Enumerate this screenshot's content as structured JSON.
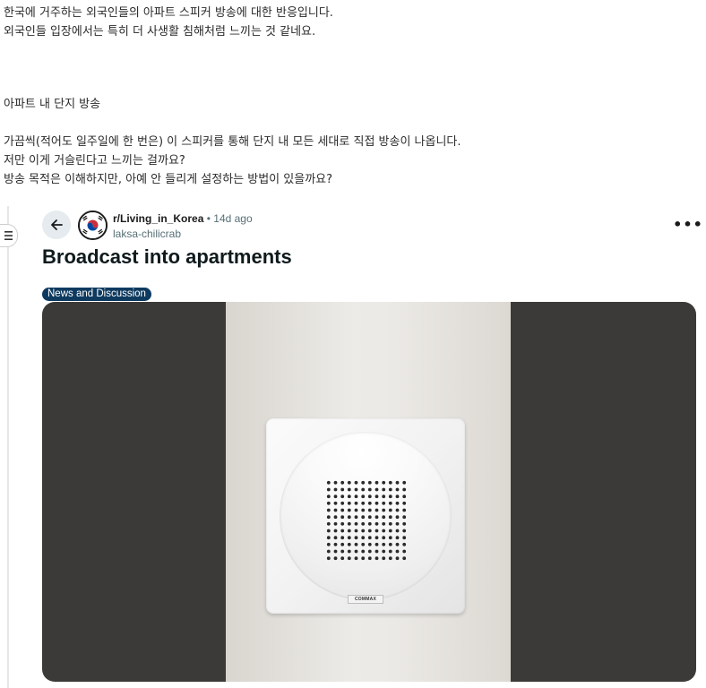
{
  "intro": {
    "lines": [
      "한국에 거주하는 외국인들의 아파트 스피커 방송에 대한 반응입니다.",
      "외국인들 입장에서는 특히 더 사생활 침해처럼 느끼는 것 같네요."
    ]
  },
  "section": {
    "heading": "아파트 내 단지 방송",
    "lines": [
      "가끔씩(적어도 일주일에 한 번은) 이 스피커를 통해 단지 내 모든 세대로 직접 방송이 나옵니다.",
      "저만 이게 거슬린다고 느끼는 걸까요?",
      "방송 목적은 이해하지만, 아예 안 들리게 설정하는 방법이 있을까요?"
    ]
  },
  "post": {
    "subreddit": "r/Living_in_Korea",
    "separator": "•",
    "age": "14d ago",
    "username": "laksa-chilicrab",
    "title": "Broadcast into apartments",
    "flair": "News and Discussion",
    "more_label": "•••",
    "image": {
      "description": "wall-mounted apartment intercom speaker",
      "brand": "COMMAX"
    }
  },
  "icons": {
    "back": "arrow-left-icon",
    "menu": "hamburger-menu-icon",
    "avatar": "korean-flag-icon",
    "more": "more-options-icon"
  },
  "colors": {
    "flair_bg": "#0e3a5f",
    "back_button_bg": "#e5ebee",
    "meta_text": "#576f76"
  }
}
